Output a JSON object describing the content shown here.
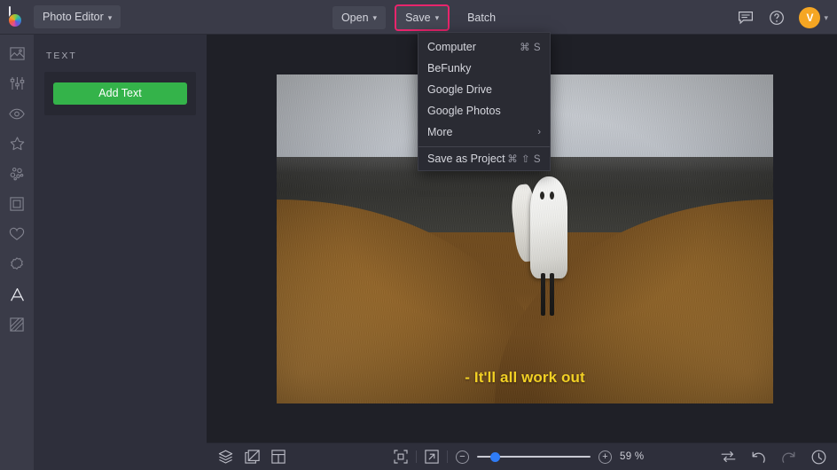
{
  "app": {
    "brand_icon": "befunky-logo-icon",
    "accent_highlight": "#e8256c",
    "green": "#34b34a",
    "avatar_color": "#f5a623"
  },
  "topbar": {
    "workspace_button": "Photo Editor",
    "open_button": "Open",
    "save_button": "Save",
    "batch_button": "Batch",
    "feedback_icon": "feedback-chat-icon",
    "help_icon": "help-question-icon",
    "avatar_initial": "V"
  },
  "save_menu": {
    "items": [
      {
        "label": "Computer",
        "shortcut": "⌘ S"
      },
      {
        "label": "BeFunky",
        "shortcut": ""
      },
      {
        "label": "Google Drive",
        "shortcut": ""
      },
      {
        "label": "Google Photos",
        "shortcut": ""
      },
      {
        "label": "More",
        "shortcut": "",
        "submenu": true
      }
    ],
    "footer": {
      "label": "Save as Project",
      "shortcut": "⌘ ⇧ S"
    }
  },
  "rail": {
    "items": [
      {
        "name": "sidebar-item-image",
        "icon": "image-icon",
        "active": false
      },
      {
        "name": "sidebar-item-edit",
        "icon": "sliders-icon",
        "active": false
      },
      {
        "name": "sidebar-item-touch-up",
        "icon": "eye-icon",
        "active": false
      },
      {
        "name": "sidebar-item-effects",
        "icon": "star-icon",
        "active": false
      },
      {
        "name": "sidebar-item-artsy",
        "icon": "dots-icon",
        "active": false
      },
      {
        "name": "sidebar-item-frames",
        "icon": "frame-icon",
        "active": false
      },
      {
        "name": "sidebar-item-overlays",
        "icon": "heart-icon",
        "active": false
      },
      {
        "name": "sidebar-item-graphics",
        "icon": "badge-icon",
        "active": false
      },
      {
        "name": "sidebar-item-text",
        "icon": "letter-a-icon",
        "active": true
      },
      {
        "name": "sidebar-item-textures",
        "icon": "texture-icon",
        "active": false
      }
    ]
  },
  "panel": {
    "title": "TEXT",
    "add_text_button": "Add Text"
  },
  "canvas": {
    "overlay_text": "- It'll all work out",
    "overlay_text_color": "#f2d024"
  },
  "bottombar": {
    "layers_icon": "layers-icon",
    "compare_icon": "compare-split-icon",
    "templates_icon": "template-panel-icon",
    "fit_icon": "fit-to-screen-icon",
    "fullscreen_icon": "expand-arrow-icon",
    "zoom_out_label": "−",
    "zoom_in_label": "+",
    "zoom_value": "59 %",
    "zoom_percent": 59,
    "slider_position_percent": 16,
    "swap_icon": "swap-arrows-icon",
    "undo_icon": "undo-arrow-icon",
    "redo_icon": "redo-arrow-icon",
    "history_icon": "history-clock-icon"
  }
}
